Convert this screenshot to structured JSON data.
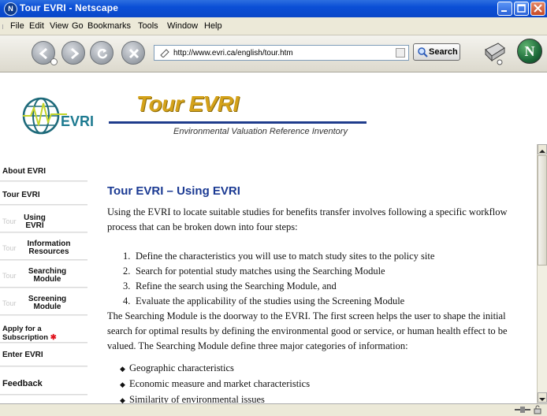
{
  "window": {
    "title": "Tour EVRI - Netscape"
  },
  "menu": [
    "File",
    "Edit",
    "View",
    "Go",
    "Bookmarks",
    "Tools",
    "Window",
    "Help"
  ],
  "toolbar": {
    "url": "http://www.evri.ca/english/tour.htm",
    "search_label": "Search"
  },
  "header": {
    "logo_text": "EVRI",
    "title": "Tour EVRI",
    "subtitle": "Environmental Valuation Reference Inventory"
  },
  "sidebar": {
    "items": [
      {
        "label": "About EVRI"
      },
      {
        "label": "Tour EVRI"
      },
      {
        "ghost": "Tour",
        "label": "Using EVRI"
      },
      {
        "ghost": "Tour",
        "label": "Information Resources"
      },
      {
        "ghost": "Tour",
        "label": "Searching Module"
      },
      {
        "ghost": "Tour",
        "label": "Screening Module"
      },
      {
        "label": "Apply for a Subscription",
        "marker": "✱"
      },
      {
        "label": "Enter EVRI"
      },
      {
        "label": "Feedback"
      }
    ]
  },
  "main": {
    "heading": "Tour EVRI – Using EVRI",
    "intro": "Using the EVRI to locate suitable studies for benefits transfer involves following a specific workflow process that can be broken down into four steps:",
    "steps": [
      "Define the characteristics you will use to match study sites to the policy site",
      "Search for potential study matches using the Searching Module",
      "Refine the search using the Searching Module, and",
      "Evaluate the applicability of the studies using the Screening Module"
    ],
    "searching_para": "The Searching Module is the doorway to the EVRI. The first screen helps the user to shape the initial search for optimal results by defining the environmental good or service, or human health effect to be valued. The Searching Module define three major categories of information:",
    "bullets": [
      "Geographic characteristics",
      "Economic measure and market characteristics",
      "Similarity of environmental issues"
    ]
  },
  "colors": {
    "heading": "#1b3a93",
    "title_gold": "#d4a21a",
    "accent_red": "#e0141e"
  },
  "icons": [
    "back-arrow-icon",
    "forward-arrow-icon",
    "reload-icon",
    "stop-icon",
    "page-icon",
    "search-magnifier-icon",
    "print-icon",
    "netscape-logo-icon"
  ]
}
